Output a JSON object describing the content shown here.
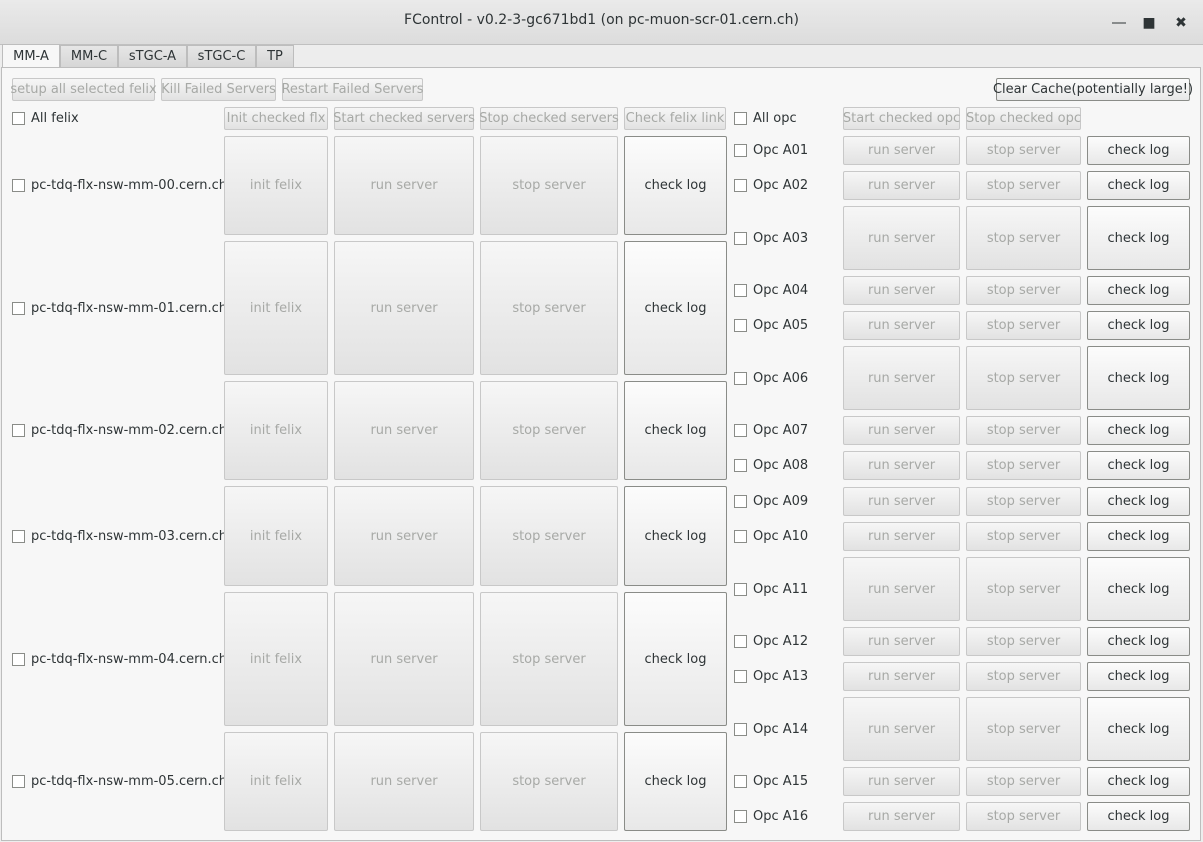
{
  "window": {
    "title": "FControl - v0.2-3-gc671bd1 (on pc-muon-scr-01.cern.ch)",
    "minimize_symbol": "―",
    "maximize_symbol": "■",
    "close_symbol": "✖"
  },
  "tabs": [
    {
      "label": "MM-A",
      "active": true
    },
    {
      "label": "MM-C"
    },
    {
      "label": "sTGC-A"
    },
    {
      "label": "sTGC-C"
    },
    {
      "label": "TP"
    }
  ],
  "toolbar": {
    "setup_all": "setup all selected felix",
    "kill_failed": "Kill Failed Servers",
    "restart_failed": "Restart Failed Servers",
    "clear_cache": "Clear Cache(potentially large!)"
  },
  "felix_header": {
    "all_felix": "All felix",
    "init_checked": "Init checked flx",
    "start_checked": "Start checked servers",
    "stop_checked": "Stop checked servers",
    "check_link": "Check felix link"
  },
  "opc_header": {
    "all_opc": "All opc",
    "start_checked": "Start checked opc",
    "stop_checked": "Stop checked opc"
  },
  "felix_rows": [
    {
      "host": "pc-tdq-flx-nsw-mm-00.cern.ch",
      "init": "init felix",
      "run": "run server",
      "stop": "stop server",
      "log": "check log"
    },
    {
      "host": "pc-tdq-flx-nsw-mm-01.cern.ch",
      "init": "init felix",
      "run": "run server",
      "stop": "stop server",
      "log": "check log"
    },
    {
      "host": "pc-tdq-flx-nsw-mm-02.cern.ch",
      "init": "init felix",
      "run": "run server",
      "stop": "stop server",
      "log": "check log"
    },
    {
      "host": "pc-tdq-flx-nsw-mm-03.cern.ch",
      "init": "init felix",
      "run": "run server",
      "stop": "stop server",
      "log": "check log"
    },
    {
      "host": "pc-tdq-flx-nsw-mm-04.cern.ch",
      "init": "init felix",
      "run": "run server",
      "stop": "stop server",
      "log": "check log"
    },
    {
      "host": "pc-tdq-flx-nsw-mm-05.cern.ch",
      "init": "init felix",
      "run": "run server",
      "stop": "stop server",
      "log": "check log"
    }
  ],
  "opc_rows": [
    {
      "name": "Opc A01",
      "run": "run server",
      "stop": "stop server",
      "log": "check log"
    },
    {
      "name": "Opc A02",
      "run": "run server",
      "stop": "stop server",
      "log": "check log"
    },
    {
      "name": "Opc A03",
      "run": "run server",
      "stop": "stop server",
      "log": "check log"
    },
    {
      "name": "Opc A04",
      "run": "run server",
      "stop": "stop server",
      "log": "check log"
    },
    {
      "name": "Opc A05",
      "run": "run server",
      "stop": "stop server",
      "log": "check log"
    },
    {
      "name": "Opc A06",
      "run": "run server",
      "stop": "stop server",
      "log": "check log"
    },
    {
      "name": "Opc A07",
      "run": "run server",
      "stop": "stop server",
      "log": "check log"
    },
    {
      "name": "Opc A08",
      "run": "run server",
      "stop": "stop server",
      "log": "check log"
    },
    {
      "name": "Opc A09",
      "run": "run server",
      "stop": "stop server",
      "log": "check log"
    },
    {
      "name": "Opc A10",
      "run": "run server",
      "stop": "stop server",
      "log": "check log"
    },
    {
      "name": "Opc A11",
      "run": "run server",
      "stop": "stop server",
      "log": "check log"
    },
    {
      "name": "Opc A12",
      "run": "run server",
      "stop": "stop server",
      "log": "check log"
    },
    {
      "name": "Opc A13",
      "run": "run server",
      "stop": "stop server",
      "log": "check log"
    },
    {
      "name": "Opc A14",
      "run": "run server",
      "stop": "stop server",
      "log": "check log"
    },
    {
      "name": "Opc A15",
      "run": "run server",
      "stop": "stop server",
      "log": "check log"
    },
    {
      "name": "Opc A16",
      "run": "run server",
      "stop": "stop server",
      "log": "check log"
    }
  ]
}
